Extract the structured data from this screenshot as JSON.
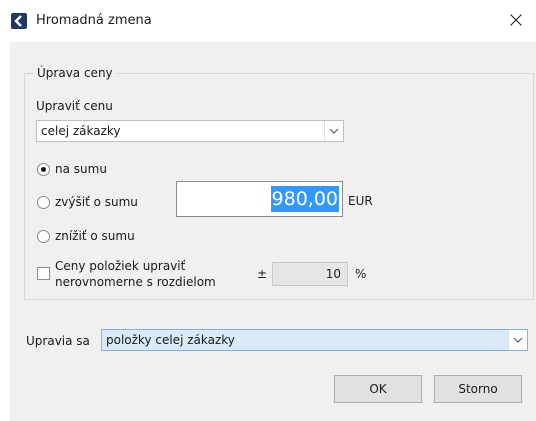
{
  "window": {
    "title": "Hromadná zmena",
    "icon": "app-logo-icon",
    "close_icon": "close-icon"
  },
  "price_group": {
    "legend": "Úprava ceny",
    "adjust_label": "Upraviť cenu",
    "adjust_select": {
      "value": "celej zákazky"
    },
    "options": {
      "set_sum": {
        "label": "na sumu",
        "checked": true
      },
      "increase": {
        "label": "zvýšiť o sumu",
        "checked": false
      },
      "decrease": {
        "label": "znížiť o sumu",
        "checked": false
      }
    },
    "amount": {
      "value": "980,00",
      "currency": "EUR"
    },
    "uneven": {
      "label_line1": "Ceny položiek upraviť",
      "label_line2": "nerovnomerne s rozdielom",
      "checked": false,
      "plus_minus": "±",
      "percent_value": "10",
      "percent_unit": "%"
    }
  },
  "applies": {
    "label": "Upravia sa",
    "select_value": "položky celej zákazky"
  },
  "buttons": {
    "ok": "OK",
    "cancel": "Storno"
  },
  "colors": {
    "accent_selection": "#3399ff",
    "dialog_bg": "#f0f0f0",
    "select_highlight": "#d9ebf9",
    "app_icon": "#1f3a66"
  }
}
